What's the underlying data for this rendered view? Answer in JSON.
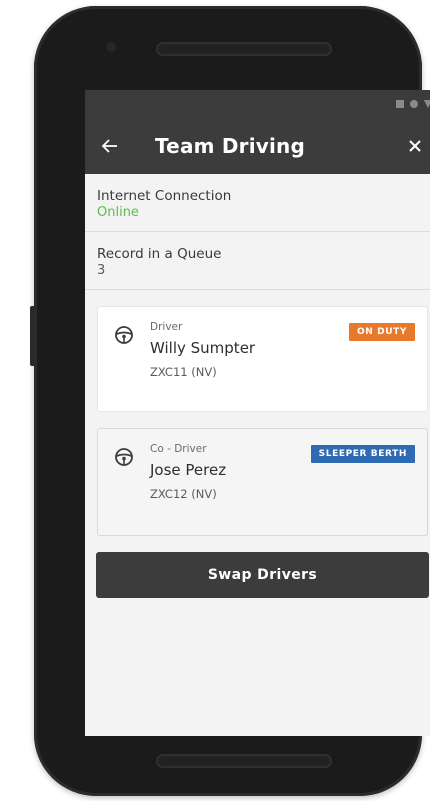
{
  "appbar": {
    "title": "Team Driving",
    "back_icon": "arrow-left-icon",
    "close_icon": "close-icon"
  },
  "statusbar": {
    "icons": [
      "signal-icon",
      "wifi-icon",
      "battery-icon"
    ]
  },
  "internet": {
    "label": "Internet Connection",
    "value": "Online",
    "value_color": "#5bbf45"
  },
  "queue": {
    "label": "Record in a Queue",
    "value": "3"
  },
  "drivers": [
    {
      "role": "Driver",
      "name": "Willy Sumpter",
      "code": "ZXC11 (NV)",
      "status": "ON DUTY",
      "status_color": "#e9792a",
      "icon": "steering-wheel-icon"
    },
    {
      "role": "Co - Driver",
      "name": "Jose Perez",
      "code": "ZXC12 (NV)",
      "status": "SLEEPER BERTH",
      "status_color": "#2f6bb5",
      "icon": "steering-wheel-icon"
    }
  ],
  "swap_button": {
    "label": "Swap Drivers"
  },
  "colors": {
    "appbar": "#3c3c3c",
    "background": "#f2f3f2",
    "phone_frame": "#1b1b1b"
  }
}
